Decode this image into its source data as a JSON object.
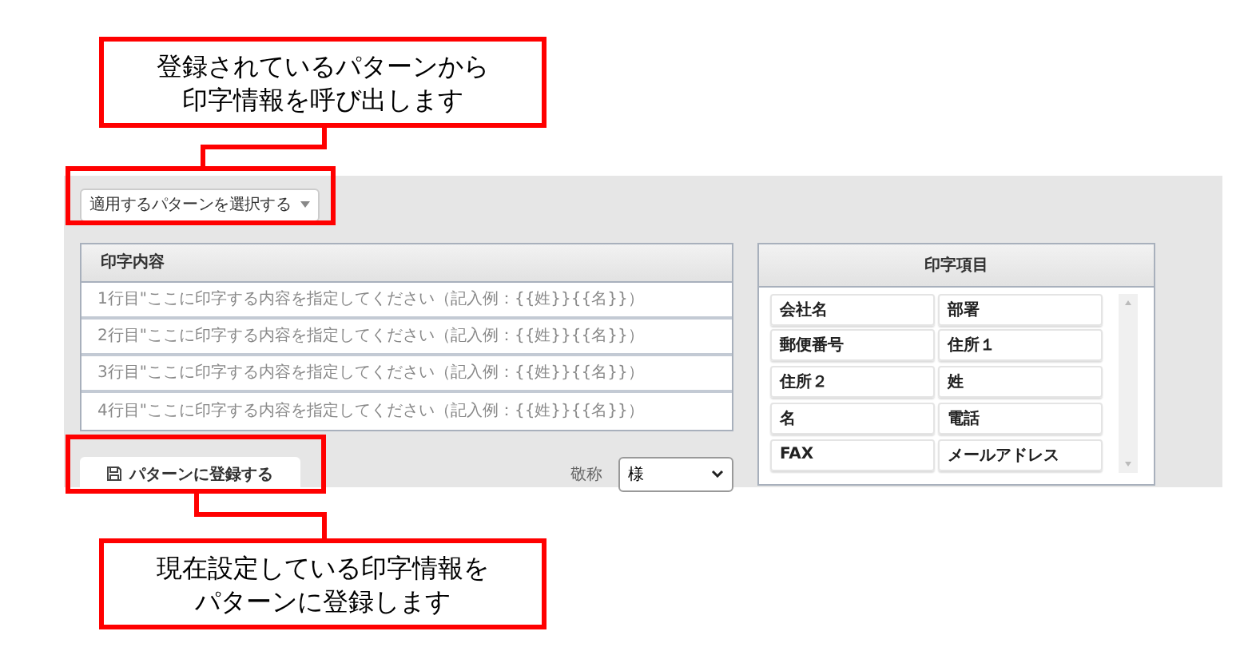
{
  "pattern_select": {
    "value": "適用するパターンを選択する"
  },
  "print_content": {
    "title": "印字内容",
    "lines": [
      {
        "placeholder": "1行目\"ここに印字する内容を指定してください（記入例：{{姓}}{{名}}）"
      },
      {
        "placeholder": "2行目\"ここに印字する内容を指定してください（記入例：{{姓}}{{名}}）"
      },
      {
        "placeholder": "3行目\"ここに印字する内容を指定してください（記入例：{{姓}}{{名}}）"
      },
      {
        "placeholder": "4行目\"ここに印字する内容を指定してください（記入例：{{姓}}{{名}}）"
      }
    ]
  },
  "register_button": {
    "label": "パターンに登録する"
  },
  "honorific": {
    "label": "敬称",
    "value": "様"
  },
  "print_items": {
    "title": "印字項目",
    "items": [
      "会社名",
      "部署",
      "郵便番号",
      "住所１",
      "住所２",
      "姓",
      "名",
      "電話",
      "FAX",
      "メールアドレス"
    ]
  },
  "callouts": [
    {
      "lines": [
        "登録されているパターンから",
        "印字情報を呼び出します"
      ]
    },
    {
      "lines": [
        "現在設定している印字情報を",
        "パターンに登録します"
      ]
    }
  ]
}
